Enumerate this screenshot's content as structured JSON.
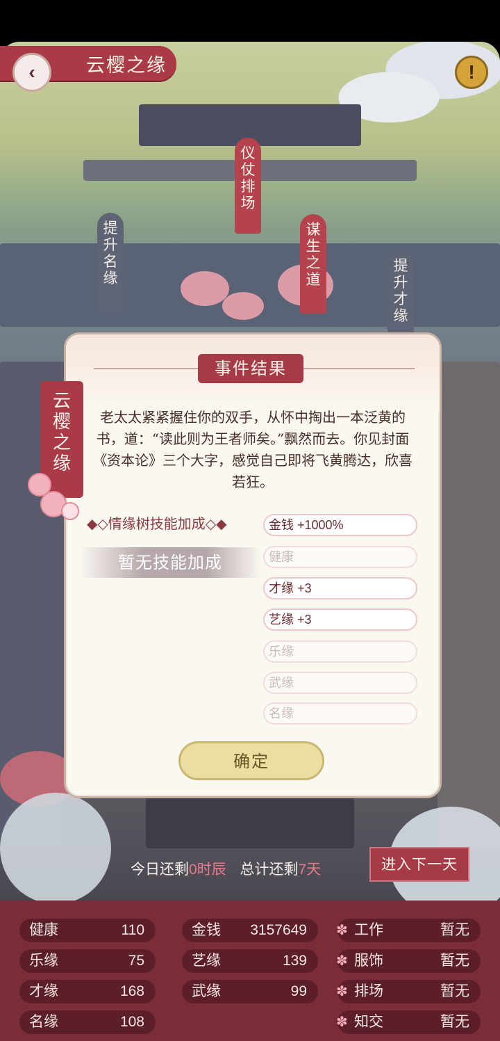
{
  "header": {
    "title": "云樱之缘"
  },
  "map": {
    "tags": [
      "仪仗排场",
      "谋生之道",
      "提升名缘",
      "提升才缘"
    ]
  },
  "dialog": {
    "title": "事件结果",
    "message": "老太太紧紧握住你的双手，从怀中掏出一本泛黄的书，道：“读此则为王者师矣。”飘然而去。你见封面《资本论》三个大字，感觉自己即将飞黄腾达，欣喜若狂。",
    "side_ribbon": "云樱之缘",
    "skill_heading": "◆◇情缘树技能加成◇◆",
    "no_skill": "暂无技能加成",
    "attributes": [
      {
        "label": "金钱 +1000%",
        "active": true
      },
      {
        "label": "健康",
        "active": false
      },
      {
        "label": "才缘 +3",
        "active": true
      },
      {
        "label": "艺缘 +3",
        "active": true
      },
      {
        "label": "乐缘",
        "active": false
      },
      {
        "label": "武缘",
        "active": false
      },
      {
        "label": "名缘",
        "active": false
      }
    ],
    "confirm": "确定"
  },
  "time": {
    "today_prefix": "今日还剩",
    "today_value": "0时辰",
    "total_prefix": "总计还剩",
    "total_value": "7天",
    "next_day": "进入下一天"
  },
  "stats": {
    "col1": [
      {
        "k": "健康",
        "v": "110"
      },
      {
        "k": "乐缘",
        "v": "75"
      },
      {
        "k": "才缘",
        "v": "168"
      },
      {
        "k": "名缘",
        "v": "108"
      }
    ],
    "col2": [
      {
        "k": "金钱",
        "v": "3157649"
      },
      {
        "k": "艺缘",
        "v": "139"
      },
      {
        "k": "武缘",
        "v": "99"
      }
    ],
    "col3": [
      {
        "k": "工作",
        "v": "暂无"
      },
      {
        "k": "服饰",
        "v": "暂无"
      },
      {
        "k": "排场",
        "v": "暂无"
      },
      {
        "k": "知交",
        "v": "暂无"
      }
    ]
  },
  "colors": {
    "accent": "#a63a47",
    "stats_bg": "#7a2c38",
    "panel_bg": "#fbf7f1"
  }
}
